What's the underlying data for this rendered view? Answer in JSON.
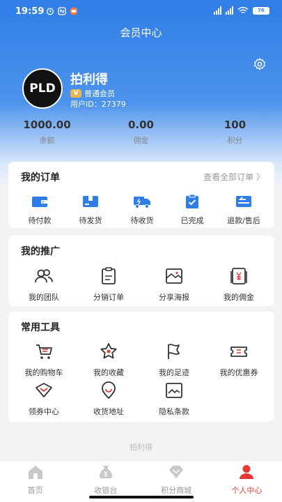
{
  "status_bar": {
    "time": "19:59",
    "battery": "76"
  },
  "nav": {
    "title": "会员中心"
  },
  "profile": {
    "avatar_text": "PLD",
    "username": "拍利得",
    "member_level": "普通会员",
    "member_badge": "V",
    "user_id_label": "用户ID：",
    "user_id": "27379"
  },
  "stats": [
    {
      "value": "1000.00",
      "label": "余额"
    },
    {
      "value": "0.00",
      "label": "佣金"
    },
    {
      "value": "100",
      "label": "积分"
    }
  ],
  "orders": {
    "title": "我的订单",
    "view_all": "查看全部订单 〉",
    "items": [
      {
        "label": "待付款",
        "icon": "wallet-icon"
      },
      {
        "label": "待发货",
        "icon": "box-icon"
      },
      {
        "label": "待收货",
        "icon": "truck-icon"
      },
      {
        "label": "已完成",
        "icon": "clipboard-check-icon"
      },
      {
        "label": "退款/售后",
        "icon": "refund-icon"
      }
    ]
  },
  "promotion": {
    "title": "我的推广",
    "items": [
      {
        "label": "我的团队",
        "icon": "team-icon"
      },
      {
        "label": "分销订单",
        "icon": "order-doc-icon"
      },
      {
        "label": "分享海报",
        "icon": "poster-icon"
      },
      {
        "label": "我的佣金",
        "icon": "commission-icon"
      }
    ]
  },
  "tools": {
    "title": "常用工具",
    "items": [
      {
        "label": "我的购物车",
        "icon": "cart-icon"
      },
      {
        "label": "我的收藏",
        "icon": "star-icon"
      },
      {
        "label": "我的足迹",
        "icon": "flag-icon"
      },
      {
        "label": "我的优惠券",
        "icon": "coupon-icon"
      },
      {
        "label": "领券中心",
        "icon": "coupon-center-icon"
      },
      {
        "label": "收货地址",
        "icon": "location-icon"
      },
      {
        "label": "隐私条款",
        "icon": "privacy-icon"
      }
    ]
  },
  "footer": {
    "brand": "拍利得"
  },
  "tabbar": [
    {
      "label": "首页",
      "icon": "home-icon",
      "active": false
    },
    {
      "label": "收银台",
      "icon": "money-bag-icon",
      "active": false
    },
    {
      "label": "积分商城",
      "icon": "diamond-icon",
      "active": false
    },
    {
      "label": "个人中心",
      "icon": "user-icon",
      "active": true
    }
  ],
  "colors": {
    "primary": "#2f7de6",
    "accent_red": "#e53935",
    "order_icon_blue": "#2f7de6"
  }
}
